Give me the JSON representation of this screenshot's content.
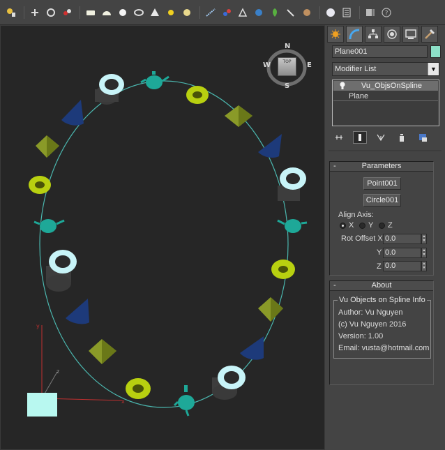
{
  "toolbar": {
    "icons": [
      "select-icon",
      "move-icon",
      "rotate-icon",
      "scale-icon",
      "box-icon",
      "sphere-icon",
      "geosphere-icon",
      "torus-icon",
      "cone-icon",
      "sun-icon",
      "sphere-gold-icon",
      "spline-icon",
      "link-icon",
      "bind-icon",
      "planet-icon",
      "particle-icon",
      "bone-icon",
      "material-icon",
      "render-icon",
      "snap-icon",
      "grid-icon",
      "help-icon"
    ]
  },
  "viewport": {
    "viewcube": {
      "top_face": "TOP",
      "north": "N",
      "south": "S",
      "east": "E",
      "west": "W"
    },
    "axes": {
      "x": "x",
      "y": "y",
      "z": "z"
    },
    "colors": {
      "background": "#262626",
      "spline": "#4bb8b0",
      "tube": "#c8f4f8",
      "torus": "#b8d010",
      "pyramid": "#8a9a28",
      "cone": "#1d3a7a",
      "teapot": "#1ea898"
    }
  },
  "panel": {
    "tabs": [
      "create-tab",
      "modify-tab",
      "hierarchy-tab",
      "motion-tab",
      "display-tab",
      "utilities-tab"
    ],
    "object_name": "Plane001",
    "object_color": "#8de0c8",
    "modifier_list": "Modifier List",
    "stack": [
      "Vu_ObjsOnSpline",
      "Plane"
    ],
    "parameters": {
      "title": "Parameters",
      "point_button": "Point001",
      "circle_button": "Circle001",
      "align_axis_label": "Align Axis:",
      "axes": [
        "X",
        "Y",
        "Z"
      ],
      "selected_axis": "X",
      "rot_offset_x_label": "Rot Offset X",
      "rot_offset_y_label": "Y",
      "rot_offset_z_label": "Z",
      "rot_offset_x": "0.0",
      "rot_offset_y": "0.0",
      "rot_offset_z": "0.0"
    },
    "about": {
      "title": "About",
      "group_title": "Vu Objects on Spline Info",
      "author": "Author: Vu Nguyen",
      "copyright": "(c) Vu Nguyen 2016",
      "version": "Version: 1.00",
      "email": "Email: vusta@hotmail.com"
    }
  }
}
